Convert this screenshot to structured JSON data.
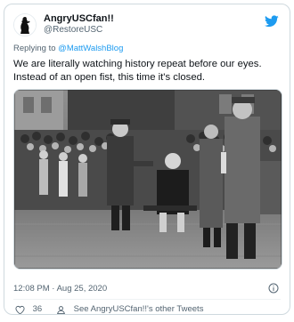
{
  "tweet": {
    "display_name": "AngryUSCfan!!",
    "handle": "@RestoreUSC",
    "reply_prefix": "Replying to",
    "reply_to": "@MattWalshBlog",
    "text_line1": "We are literally watching history repeat before our eyes.",
    "text_line2": "Instead of an open fist, this time it's closed.",
    "timestamp": "12:08 PM · Aug 25, 2020",
    "like_count": "36",
    "profile_link": "See AngryUSCfan!!'s other Tweets"
  },
  "icons": {
    "brand": "twitter-bird-icon",
    "info": "info-icon",
    "like": "heart-icon",
    "profile": "person-icon"
  },
  "colors": {
    "brand_blue": "#1d9bf0",
    "text_primary": "#0f1419",
    "text_secondary": "#536471",
    "border": "#cfd9de"
  }
}
